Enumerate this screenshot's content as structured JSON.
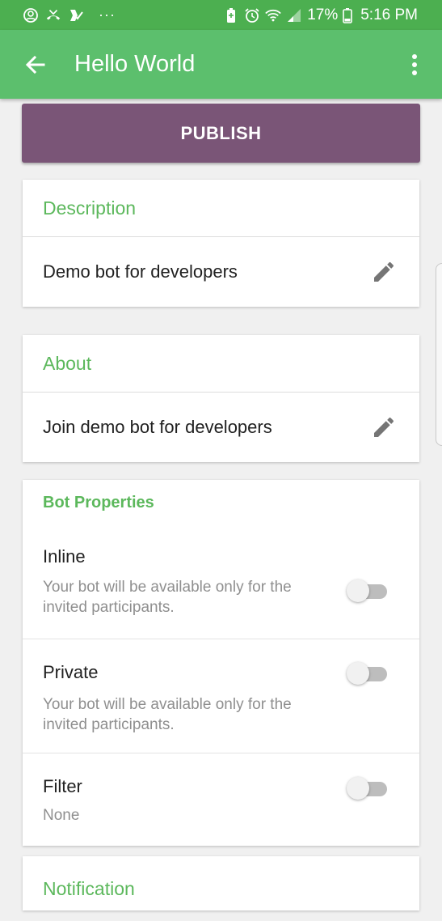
{
  "status_bar": {
    "dots": "···",
    "battery_pct": "17%",
    "time": "5:16 PM"
  },
  "app_bar": {
    "title": "Hello World"
  },
  "publish_label": "PUBLISH",
  "description": {
    "header": "Description",
    "value": "Demo bot for developers"
  },
  "about": {
    "header": "About",
    "value": "Join demo bot for developers"
  },
  "bot_properties": {
    "header": "Bot Properties",
    "items": [
      {
        "title": "Inline",
        "desc": "Your bot will be available only for the invited participants.",
        "enabled": false
      },
      {
        "title": "Private",
        "desc": "Your bot will be available only for the invited participants.",
        "enabled": false
      },
      {
        "title": "Filter",
        "desc": "None",
        "enabled": false
      }
    ]
  },
  "notification": {
    "header": "Notification"
  },
  "colors": {
    "status_bar": "#4caf50",
    "app_bar": "#5cbf6d",
    "publish": "#7a5577",
    "accent": "#5cb85c"
  }
}
